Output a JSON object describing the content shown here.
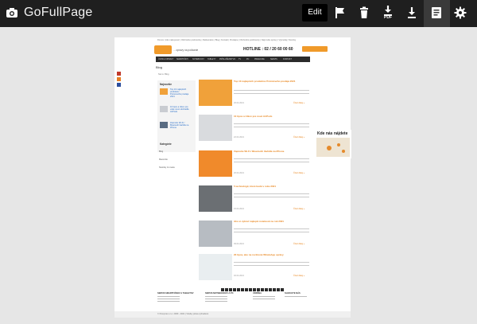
{
  "app": {
    "title": "GoFullPage"
  },
  "toolbar": {
    "edit_label": "Edit",
    "icons": [
      "camera-icon",
      "flag-icon",
      "trash-icon",
      "pdf-download-icon",
      "download-icon",
      "document-icon",
      "gear-icon"
    ],
    "pdf_label": "PDF",
    "accent": "#f09a2a"
  },
  "page": {
    "top_links": "Domov | Ako nakupovať | Obchodné podmienky | Reklamácie | Blog | Kontakt | Predajne | Obchodné podmienky | Najnovšie správy | Výpredaj | Novinky",
    "tagline": "... opravy na počkanie",
    "hotline": "HOTLINE : 02 / 20 60 00 60",
    "cart": "Nákupný košík",
    "nav": [
      "ÚVOD A OPRAVY",
      "SMARTFÓNY",
      "NOTEBOOKY",
      "TABLETY",
      "PRÍSLUŠENSTVO",
      "TV",
      "PC",
      "PREDAJNE",
      "SERVIS",
      "KONTAKT"
    ],
    "blog_heading": "Blog",
    "crumb": "Ste tu: Blog",
    "sidebar": {
      "heading": "Najnovšie",
      "items": [
        "Top 10 najlepších produktov Prémiového predaja 2021",
        "10 tipov a trikov pre vaše nové slúchadlá AirPods",
        "Zapnutie Wi-Fi / Bluetooth tlačidla na iPhone"
      ],
      "cat_heading": "Kategórie",
      "cats": [
        "Blog",
        "Recenzie",
        "Novinky zo sveta"
      ]
    },
    "posts": [
      {
        "title": "Top 10 najlepších produktov Prémiového predaja 2021",
        "date": "26.04.2021",
        "more": "Čítať ďalej »"
      },
      {
        "title": "10 tipov a trikov pre nové AirPods",
        "date": "22.04.2021",
        "more": "Čítať ďalej »"
      },
      {
        "title": "Zapnutie Wi-Fi / Bluetooth tlačidla na iPhone",
        "date": "20.04.2021",
        "more": "Čítať ďalej »"
      },
      {
        "title": "5 technológií, ktoré budú v roku 2021",
        "date": "15.04.2021",
        "more": "Čítať ďalej »"
      },
      {
        "title": "Ako si vybrať najlepší notebook na rok 2021",
        "date": "09.04.2021",
        "more": "Čítať ďalej »"
      },
      {
        "title": "20 tipov, ako na rozšírené WhatsApp správy",
        "date": "02.04.2021",
        "more": "Čítať ďalej »"
      }
    ],
    "footer_cols": [
      "SERVIS SMARTFÓNOV A TABLETOV",
      "SERVIS NOTEBOOKOV A PC",
      "ÚDRŽBA",
      "SLEDUJTE NÁS"
    ],
    "kde_heading": "Kde nás nájdete",
    "copyright": "© Pcexpres s.r.o. 2009 - 2021 | Všetky práva vyhradené"
  }
}
